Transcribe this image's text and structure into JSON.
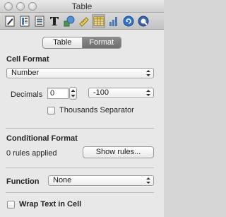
{
  "window": {
    "title": "Table"
  },
  "toolbar": {
    "icons": [
      "document-inspector-icon",
      "layout-inspector-icon",
      "wrap-inspector-icon",
      "text-inspector-icon",
      "graphic-inspector-icon",
      "metrics-inspector-icon",
      "table-inspector-icon",
      "chart-inspector-icon",
      "link-inspector-icon",
      "quicktime-inspector-icon"
    ],
    "active": "table-inspector-icon"
  },
  "tabs": {
    "table": "Table",
    "format": "Format",
    "active": "Format"
  },
  "cell_format": {
    "title": "Cell Format",
    "format_value": "Number",
    "decimals_label": "Decimals",
    "decimals_value": "0",
    "negative_value": "-100",
    "thousands_label": "Thousands Separator",
    "thousands_checked": false
  },
  "conditional_format": {
    "title": "Conditional Format",
    "status": "0 rules applied",
    "show_rules_label": "Show rules..."
  },
  "function": {
    "label": "Function",
    "value": "None"
  },
  "wrap_text": {
    "label": "Wrap Text in Cell",
    "checked": false
  },
  "colors": {
    "active_segment": "#7b7b7b",
    "background": "#e8e8e8"
  }
}
